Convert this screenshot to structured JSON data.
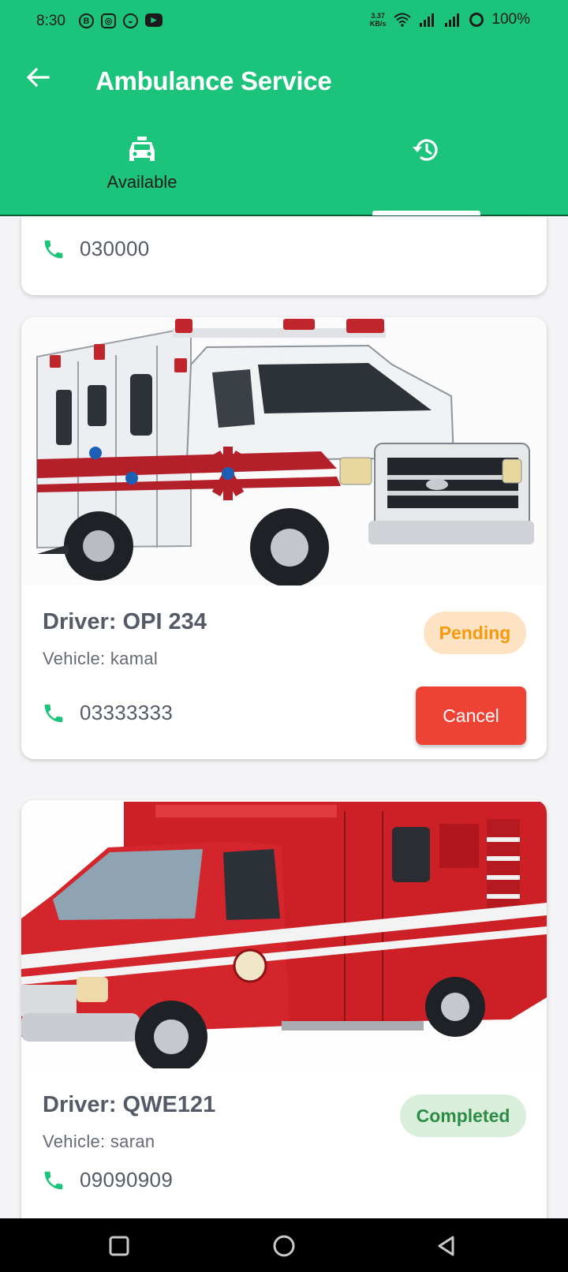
{
  "status_bar": {
    "time": "8:30",
    "apps": [
      {
        "icon": "b-app-icon",
        "glyph": "B"
      },
      {
        "icon": "instagram-icon",
        "glyph": "◎"
      },
      {
        "icon": "chat-icon",
        "glyph": "◒"
      },
      {
        "icon": "youtube-icon",
        "glyph": "▶"
      }
    ],
    "net_speed_value": "3.37",
    "net_speed_unit": "KB/s",
    "battery": "100%"
  },
  "app_bar": {
    "title": "Ambulance Service"
  },
  "tabs": [
    {
      "label": "Available",
      "icon": "taxi-icon",
      "selected": false
    },
    {
      "label": "",
      "icon": "history-icon",
      "selected": true
    }
  ],
  "bookings": [
    {
      "phone": "030000"
    },
    {
      "driver": "Driver: OPI 234",
      "vehicle": "Vehicle: kamal",
      "status": "Pending",
      "phone": "03333333",
      "action": "Cancel"
    },
    {
      "driver": "Driver: QWE121",
      "vehicle": "Vehicle: saran",
      "status": "Completed",
      "phone": "09090909"
    }
  ],
  "colors": {
    "primary": "#1cc47b",
    "pending_bg": "#fde3c4",
    "pending_text": "#f39a0e",
    "completed_bg": "#d9efdc",
    "completed_text": "#2e8b46",
    "cancel": "#ee4235"
  }
}
